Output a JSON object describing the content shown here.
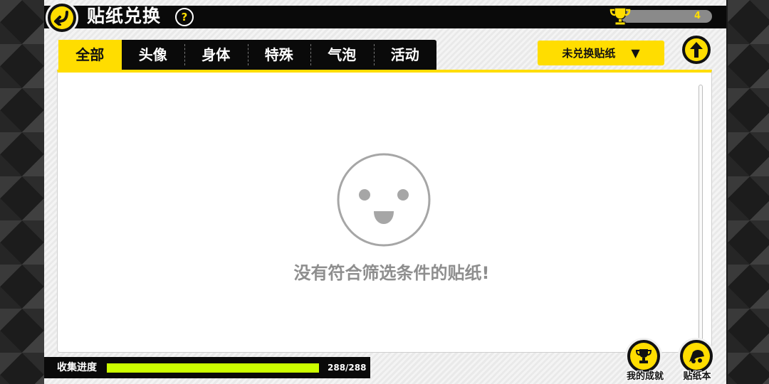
{
  "header": {
    "title": "贴纸兑换",
    "help_label": "?",
    "score": "4"
  },
  "tabs": [
    {
      "label": "全部",
      "active": true
    },
    {
      "label": "头像",
      "active": false
    },
    {
      "label": "身体",
      "active": false
    },
    {
      "label": "特殊",
      "active": false
    },
    {
      "label": "气泡",
      "active": false
    },
    {
      "label": "活动",
      "active": false
    }
  ],
  "filter": {
    "selected": "未兑换贴纸",
    "caret": "▼"
  },
  "empty_message": "没有符合筛选条件的贴纸!",
  "progress": {
    "label": "收集进度",
    "text": "288/288",
    "fraction": 1.0
  },
  "bottom_buttons": {
    "achievements_label": "我的成就",
    "sticker_book_label": "贴纸本"
  },
  "colors": {
    "accent": "#ffdd00",
    "progress": "#ccff00",
    "bar": "#0a0a0a",
    "muted_text": "#8e8e8e"
  },
  "icons": {
    "back": "back-arrow-icon",
    "up": "up-arrow-icon",
    "trophy": "trophy-icon",
    "smiley": "smiley-face-icon",
    "achievements": "trophy-icon",
    "sticker_book": "sticker-book-icon"
  }
}
